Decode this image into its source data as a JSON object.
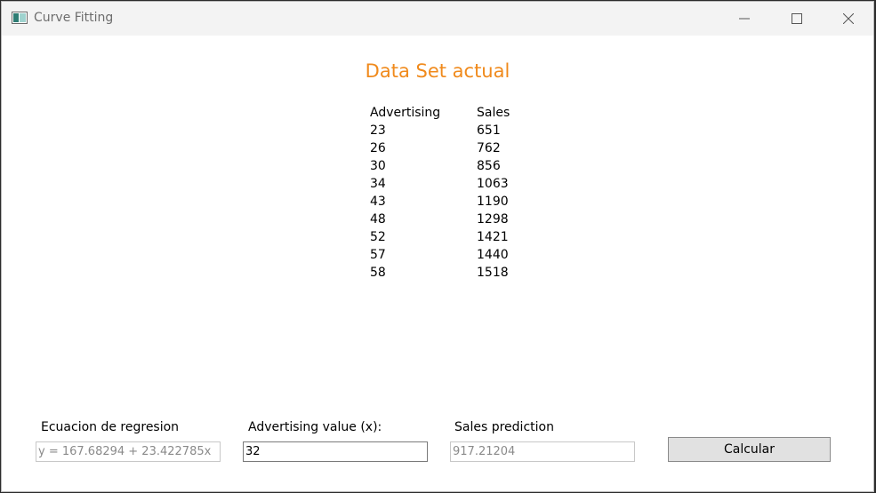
{
  "window": {
    "title": "Curve Fitting"
  },
  "main": {
    "heading": "Data Set actual",
    "table": {
      "headers": [
        "Advertising",
        "Sales"
      ],
      "rows": [
        [
          "23",
          "651"
        ],
        [
          "26",
          "762"
        ],
        [
          "30",
          "856"
        ],
        [
          "34",
          "1063"
        ],
        [
          "43",
          "1190"
        ],
        [
          "48",
          "1298"
        ],
        [
          "52",
          "1421"
        ],
        [
          "57",
          "1440"
        ],
        [
          "58",
          "1518"
        ]
      ]
    }
  },
  "form": {
    "regression_label": "Ecuacion de regresion",
    "regression_value": "y = 167.68294 + 23.422785x",
    "advertising_label": "Advertising value (x):",
    "advertising_value": "32",
    "prediction_label": "Sales prediction",
    "prediction_value": "917.21204",
    "calculate_label": "Calcular"
  },
  "colors": {
    "heading": "#f08a1c",
    "titlebar": "#f3f3f3",
    "button_bg": "#e1e1e1"
  },
  "icons": [
    "app-icon",
    "minimize-icon",
    "maximize-icon",
    "close-icon"
  ]
}
